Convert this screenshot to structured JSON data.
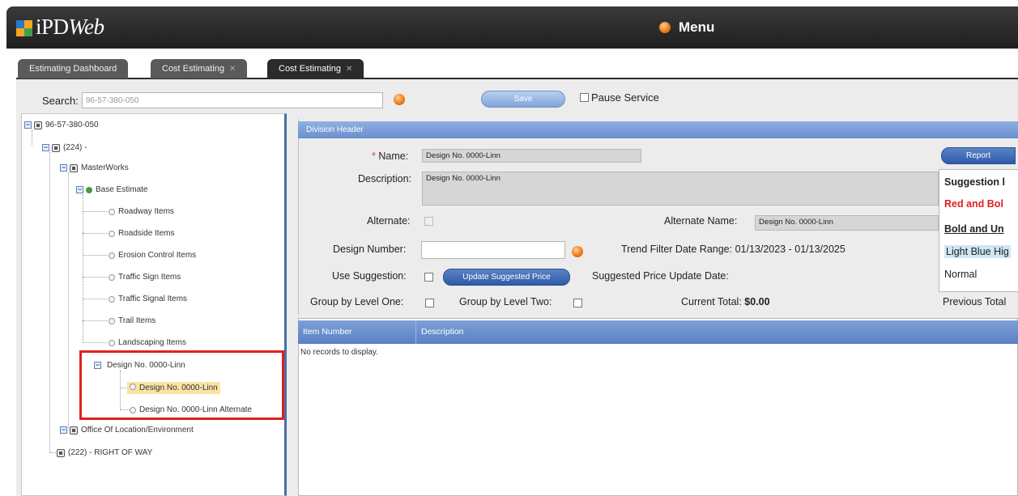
{
  "app": {
    "logo_text_a": "iPD",
    "logo_text_b": "Web",
    "menu_label": "Menu"
  },
  "tabs": [
    {
      "label": "Estimating Dashboard",
      "closable": false,
      "active": false
    },
    {
      "label": "Cost Estimating",
      "closable": true,
      "active": false
    },
    {
      "label": "Cost Estimating",
      "closable": true,
      "active": true
    }
  ],
  "toolbar": {
    "search_label": "Search:",
    "search_value": "96-57-380-050",
    "save_label": "Save",
    "pause_label": "Pause Service"
  },
  "tree": {
    "root": "96-57-380-050",
    "n224": "(224) -",
    "masterworks": "MasterWorks",
    "base_estimate": "Base Estimate",
    "roadway": "Roadway Items",
    "roadside": "Roadside Items",
    "erosion": "Erosion Control Items",
    "traffic_sign": "Traffic Sign Items",
    "traffic_signal": "Traffic Signal Items",
    "trail": "Trail Items",
    "landscaping": "Landscaping Items",
    "design_parent": "Design No. 0000-Linn",
    "design_child": "Design No. 0000-Linn",
    "design_alt": "Design No. 0000-Linn Alternate",
    "office": "Office Of Location/Environment",
    "n222": "(222) - RIGHT OF WAY"
  },
  "division": {
    "header_title": "Division Header",
    "name_label": "Name:",
    "name_value": "Design No. 0000-Linn",
    "description_label": "Description:",
    "description_value": "Design No. 0000-Linn",
    "alternate_label": "Alternate:",
    "alternate_name_label": "Alternate Name:",
    "alternate_name_value": "Design No. 0000-Linn",
    "design_number_label": "Design Number:",
    "trend_label": "Trend Filter Date Range: 01/13/2023 - 01/13/2025",
    "use_suggestion_label": "Use Suggestion:",
    "update_price_label": "Update Suggested Price",
    "suggested_date_label": "Suggested Price Update Date:",
    "group_one_label": "Group by Level One:",
    "group_two_label": "Group by Level Two:",
    "current_total_label": "Current Total:",
    "current_total_value": "$0.00",
    "report_label": "Report",
    "previous_total_label": "Previous Total"
  },
  "legend": {
    "title": "Suggestion l",
    "red_bold": "Red and Bol",
    "bold_underline": "Bold and Un",
    "light_blue": "Light Blue Hig",
    "normal": "Normal"
  },
  "grid": {
    "columns": [
      "Item Number",
      "Description"
    ],
    "empty_text": "No records to display."
  },
  "colors": {
    "topbar": "#2b2b2b",
    "accent_blue": "#5a80c3",
    "highlight": "#fbe3a4",
    "selection_box": "#e02020",
    "orange": "#f07a1a"
  }
}
